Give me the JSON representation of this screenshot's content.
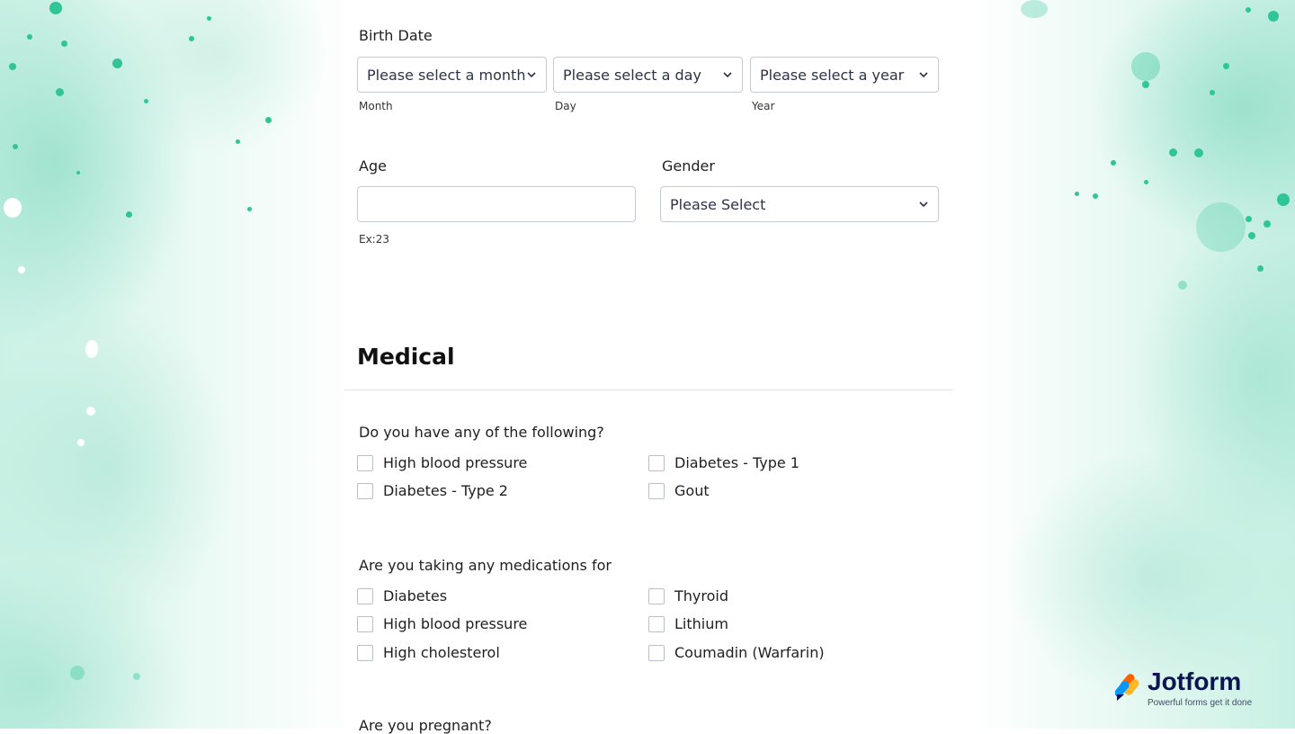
{
  "birth_date": {
    "label": "Birth Date",
    "month": {
      "placeholder": "Please select a month",
      "sublabel": "Month"
    },
    "day": {
      "placeholder": "Please select a day",
      "sublabel": "Day"
    },
    "year": {
      "placeholder": "Please select a year",
      "sublabel": "Year"
    }
  },
  "age": {
    "label": "Age",
    "value": "",
    "sublabel": "Ex:23"
  },
  "gender": {
    "label": "Gender",
    "selected": "Please Select"
  },
  "medical": {
    "title": "Medical",
    "conditions": {
      "question": "Do you have any of the following?",
      "options": [
        "High blood pressure",
        "Diabetes - Type 1",
        "Diabetes - Type 2",
        "Gout"
      ]
    },
    "medications": {
      "question": "Are you taking any medications for",
      "options": [
        "Diabetes",
        "Thyroid",
        "High blood pressure",
        "Lithium",
        "High cholesterol",
        "Coumadin (Warfarin)"
      ]
    },
    "pregnant": {
      "question": "Are you pregnant?"
    }
  },
  "branding": {
    "name": "Jotform",
    "tagline": "Powerful forms get it done"
  },
  "colors": {
    "accent": "#2fc596",
    "text": "#1f1f1f",
    "border": "#c3cad8",
    "brand_navy": "#0a1551"
  }
}
